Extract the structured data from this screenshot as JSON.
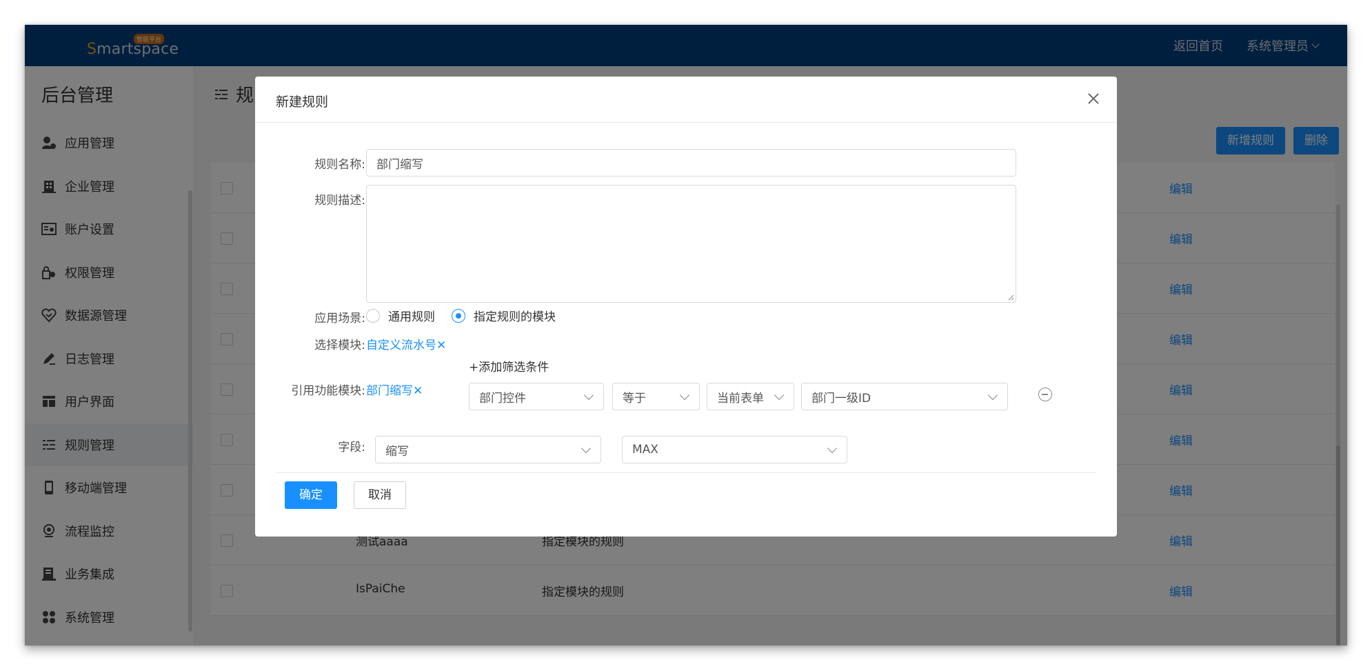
{
  "header": {
    "logo_text_s": "S",
    "logo_text_rest": "martspace",
    "logo_badge": "智能平台",
    "home_link": "返回首页",
    "user_menu": "系统管理员"
  },
  "sidebar": {
    "title": "后台管理",
    "items": [
      {
        "label": "应用管理",
        "icon": "app-icon"
      },
      {
        "label": "企业管理",
        "icon": "building-icon"
      },
      {
        "label": "账户设置",
        "icon": "account-icon"
      },
      {
        "label": "权限管理",
        "icon": "permission-icon"
      },
      {
        "label": "数据源管理",
        "icon": "datasource-icon"
      },
      {
        "label": "日志管理",
        "icon": "log-icon"
      },
      {
        "label": "用户界面",
        "icon": "layout-icon"
      },
      {
        "label": "规则管理",
        "icon": "rules-icon"
      },
      {
        "label": "移动端管理",
        "icon": "mobile-icon"
      },
      {
        "label": "流程监控",
        "icon": "monitor-icon"
      },
      {
        "label": "业务集成",
        "icon": "integration-icon"
      },
      {
        "label": "系统管理",
        "icon": "system-icon"
      }
    ]
  },
  "main": {
    "title": "规则管理",
    "add_button": "新增规则",
    "delete_button": "删除",
    "rows": [
      {
        "name": "",
        "scene": "",
        "action": "编辑"
      },
      {
        "name": "",
        "scene": "",
        "action": "编辑"
      },
      {
        "name": "",
        "scene": "",
        "action": "编辑"
      },
      {
        "name": "",
        "scene": "",
        "action": "编辑"
      },
      {
        "name": "",
        "scene": "",
        "action": "编辑"
      },
      {
        "name": "",
        "scene": "",
        "action": "编辑"
      },
      {
        "name": "",
        "scene": "",
        "action": "编辑"
      },
      {
        "name": "测试aaaa",
        "scene": "指定模块的规则",
        "action": "编辑"
      },
      {
        "name": "IsPaiChe",
        "scene": "指定模块的规则",
        "action": "编辑"
      }
    ]
  },
  "modal": {
    "title": "新建规则",
    "name_label": "规则名称:",
    "name_value": "部门缩写",
    "desc_label": "规则描述:",
    "desc_value": "",
    "scene_label": "应用场景:",
    "scene_options": [
      "通用规则",
      "指定规则的模块"
    ],
    "scene_selected": "指定规则的模块",
    "module_label": "选择模块:",
    "module_value": "自定义流水号✕",
    "add_filter": "+添加筛选条件",
    "ref_label": "引用功能模块:",
    "ref_value": "部门缩写✕",
    "filter": {
      "field": "部门控件",
      "operator": "等于",
      "source": "当前表单",
      "target": "部门一级ID"
    },
    "field_label": "字段:",
    "field_value": "缩写",
    "agg_value": "MAX",
    "ok_button": "确定",
    "cancel_button": "取消"
  },
  "colors": {
    "header_bg": "#003f7d",
    "primary": "#1890ff"
  }
}
